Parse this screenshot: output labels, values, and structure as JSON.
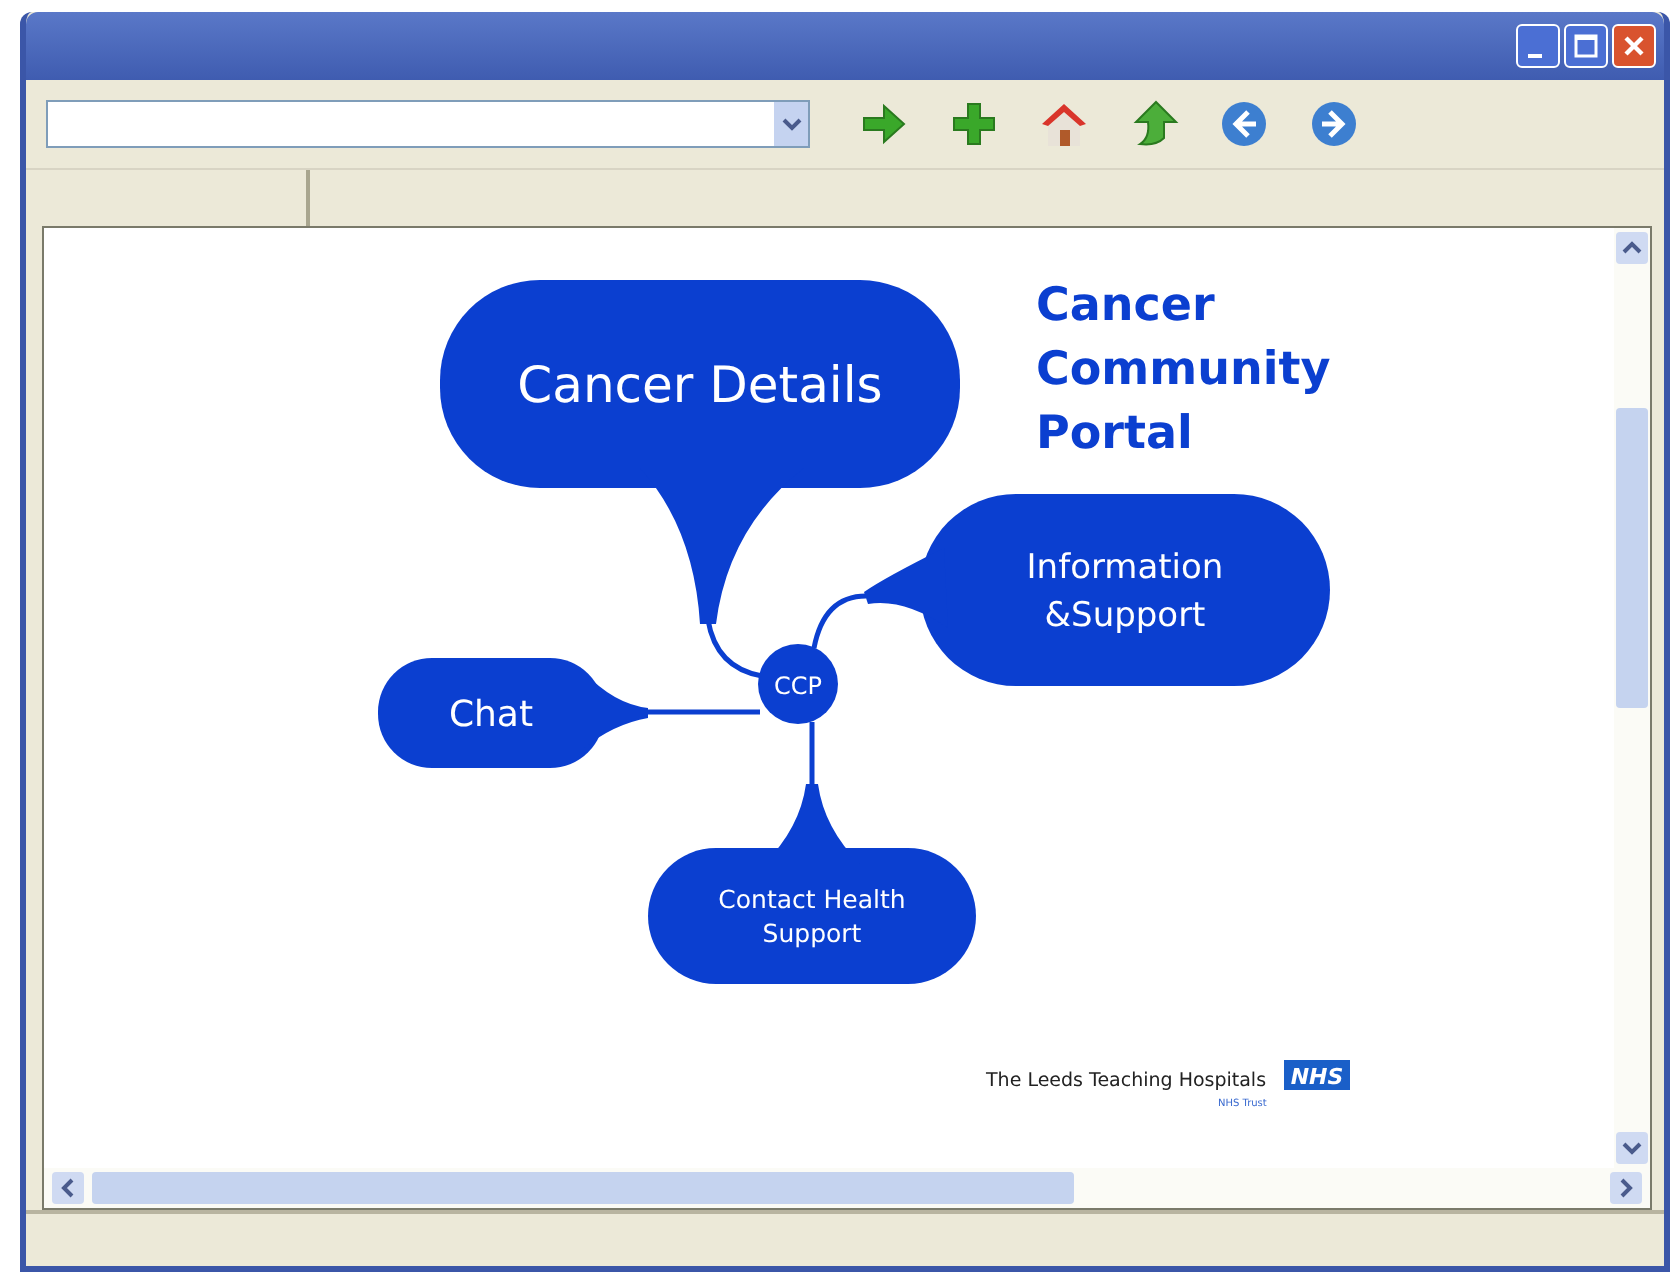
{
  "content": {
    "title": [
      "Cancer",
      "Community",
      "Portal"
    ],
    "hub": "CCP",
    "nodes": [
      {
        "lines": [
          "Cancer Details"
        ]
      },
      {
        "lines": [
          "Information",
          "&Support"
        ]
      },
      {
        "lines": [
          "Chat"
        ]
      },
      {
        "lines": [
          "Contact Health",
          "Support"
        ]
      }
    ],
    "logo": {
      "name": "The Leeds Teaching Hospitals",
      "badge": "NHS",
      "subtitle": "NHS Trust"
    }
  }
}
